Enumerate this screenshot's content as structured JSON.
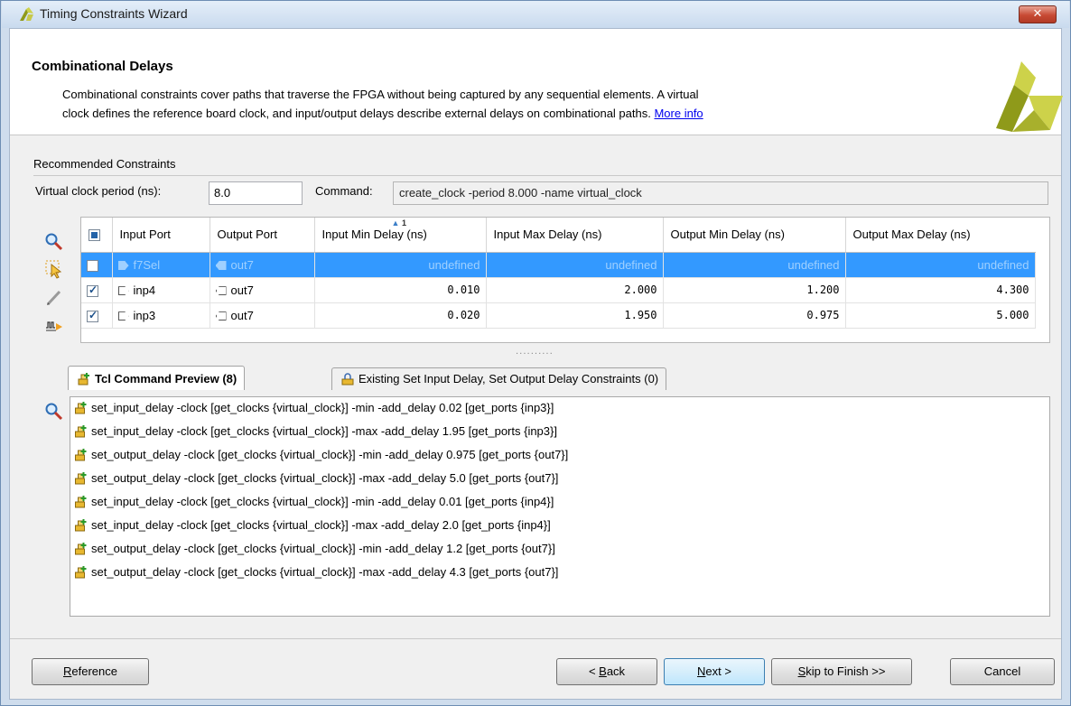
{
  "window": {
    "title": "Timing Constraints Wizard",
    "close_label": "✕"
  },
  "header": {
    "title": "Combinational Delays",
    "desc_line1": "Combinational constraints cover paths that traverse the FPGA without being captured by any sequential elements. A virtual",
    "desc_line2": "clock defines the reference board clock, and input/output delays describe external delays on combinational paths.",
    "more_info": "More info"
  },
  "recommended": {
    "label": "Recommended Constraints",
    "vc_label": "Virtual clock period (ns):",
    "vc_value": "8.0",
    "cmd_label": "Command:",
    "cmd_value": "create_clock -period 8.000 -name virtual_clock"
  },
  "table": {
    "columns": [
      "Input Port",
      "Output Port",
      "Input Min Delay (ns)",
      "Input Max Delay (ns)",
      "Output Min Delay (ns)",
      "Output Max Delay (ns)"
    ],
    "sort_index": "1",
    "rows": [
      {
        "checked": false,
        "selected": true,
        "input": "f7Sel",
        "output": "out7",
        "in_min": "undefined",
        "in_max": "undefined",
        "out_min": "undefined",
        "out_max": "undefined"
      },
      {
        "checked": true,
        "selected": false,
        "input": "inp4",
        "output": "out7",
        "in_min": "0.010",
        "in_max": "2.000",
        "out_min": "1.200",
        "out_max": "4.300"
      },
      {
        "checked": true,
        "selected": false,
        "input": "inp3",
        "output": "out7",
        "in_min": "0.020",
        "in_max": "1.950",
        "out_min": "0.975",
        "out_max": "5.000"
      }
    ]
  },
  "tabs": [
    {
      "label": "Tcl Command Preview (8)",
      "active": true
    },
    {
      "label": "Existing Set Input Delay, Set Output Delay Constraints (0)",
      "active": false
    }
  ],
  "preview_lines": [
    "set_input_delay -clock [get_clocks {virtual_clock}] -min -add_delay 0.02 [get_ports {inp3}]",
    "set_input_delay -clock [get_clocks {virtual_clock}] -max -add_delay 1.95 [get_ports {inp3}]",
    "set_output_delay -clock [get_clocks {virtual_clock}] -min -add_delay 0.975 [get_ports {out7}]",
    "set_output_delay -clock [get_clocks {virtual_clock}] -max -add_delay 5.0 [get_ports {out7}]",
    "set_input_delay -clock [get_clocks {virtual_clock}] -min -add_delay 0.01 [get_ports {inp4}]",
    "set_input_delay -clock [get_clocks {virtual_clock}] -max -add_delay 2.0 [get_ports {inp4}]",
    "set_output_delay -clock [get_clocks {virtual_clock}] -min -add_delay 1.2 [get_ports {out7}]",
    "set_output_delay -clock [get_clocks {virtual_clock}] -max -add_delay 4.3 [get_ports {out7}]"
  ],
  "buttons": {
    "reference": {
      "mnemonic": "R",
      "rest": "eference"
    },
    "back": {
      "prefix": "< ",
      "mnemonic": "B",
      "rest": "ack"
    },
    "next": {
      "mnemonic": "N",
      "rest": "ext >"
    },
    "skip": {
      "mnemonic": "S",
      "rest": "kip to Finish >>"
    },
    "cancel": "Cancel"
  },
  "icons": {
    "side_tools": [
      "search-icon",
      "select-arrow-icon",
      "edit-pencil-icon",
      "waveform-icon"
    ],
    "preview_tools": [
      "search-icon"
    ],
    "line_icon": "tcl-add-icon",
    "tab_icons": [
      "tcl-add-icon",
      "lock-constraint-icon"
    ]
  },
  "colors": {
    "selection": "#3399ff",
    "link": "#0000ee",
    "logo_yellow": "#cdd24a",
    "logo_olive": "#8f9a1a"
  }
}
